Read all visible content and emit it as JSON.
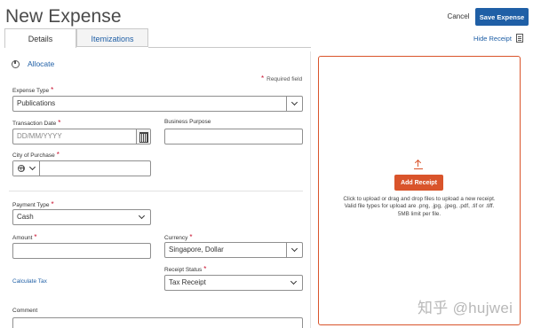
{
  "header": {
    "title": "New Expense",
    "cancel_label": "Cancel",
    "save_label": "Save Expense"
  },
  "tabs": [
    {
      "label": "Details",
      "active": true
    },
    {
      "label": "Itemizations",
      "active": false
    }
  ],
  "receipt_toggle": {
    "label": "Hide Receipt",
    "icon": "document-icon"
  },
  "allocate": {
    "label": "Allocate",
    "icon": "allocate-icon"
  },
  "required_note": "Required field",
  "form": {
    "expense_type": {
      "label": "Expense Type",
      "value": "Publications",
      "required": true
    },
    "transaction_date": {
      "label": "Transaction Date",
      "placeholder": "DD/MM/YYYY",
      "required": true
    },
    "business_purpose": {
      "label": "Business Purpose",
      "value": ""
    },
    "city_of_purchase": {
      "label": "City of Purchase",
      "value": "",
      "required": true
    },
    "payment_type": {
      "label": "Payment Type",
      "value": "Cash",
      "required": true
    },
    "amount": {
      "label": "Amount",
      "value": "",
      "required": true
    },
    "currency": {
      "label": "Currency",
      "value": "Singapore, Dollar",
      "required": true
    },
    "receipt_status": {
      "label": "Receipt Status",
      "value": "Tax Receipt",
      "required": true
    },
    "calculate_tax": "Calculate Tax",
    "comment": {
      "label": "Comment"
    }
  },
  "receipt_panel": {
    "button_label": "Add Receipt",
    "instructions_line1": "Click to upload or drag and drop files to upload a new receipt.",
    "instructions_line2": "Valid file types for upload are .png, .jpg, .jpeg, .pdf, .tif or .tiff.",
    "instructions_line3": "5MB limit per file."
  },
  "watermark": "知乎 @hujwei",
  "colors": {
    "primary": "#1f5fa6",
    "accent": "#d9542b",
    "required": "#c8102e"
  }
}
